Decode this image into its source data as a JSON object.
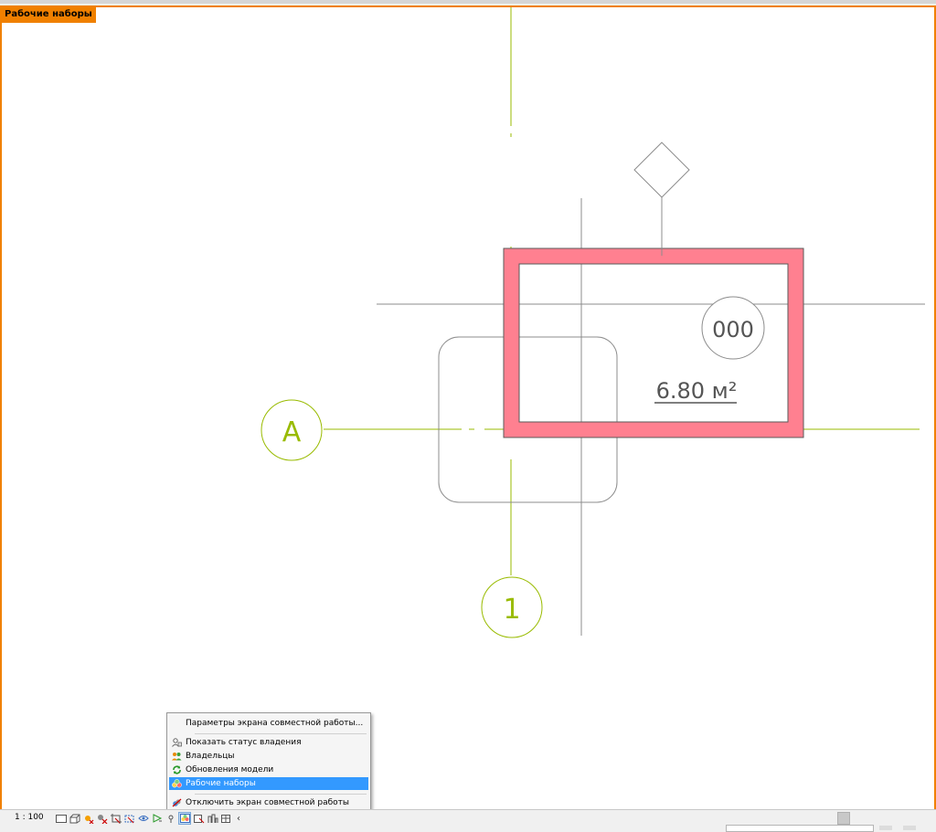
{
  "viewport": {
    "mode_label": "Рабочие наборы",
    "border_color": "#f08000"
  },
  "drawing": {
    "room_number": "000",
    "room_area": "6.80 м²",
    "grid_row_label": "A",
    "grid_column_label": "1",
    "room_highlight_color": "#ff8090",
    "grid_color": "#99bb00"
  },
  "statusbar": {
    "scale": "1 : 100",
    "icons": [
      "detail-level-icon",
      "visual-style-icon",
      "sun-path-icon",
      "shadows-icon",
      "crop-view-icon",
      "show-crop-icon",
      "temporary-hide-icon",
      "reveal-hidden-icon",
      "analytical-icon",
      "worksharing-display-icon",
      "highlight-displacement-icon",
      "reveal-constraints-icon",
      "design-options-icon"
    ],
    "expand_arrow": "‹"
  },
  "context_menu": {
    "items": [
      {
        "label": "Параметры экрана совместной работы...",
        "icon": ""
      },
      {
        "label": "Показать статус владения",
        "icon": "ownership-status-icon"
      },
      {
        "label": "Владельцы",
        "icon": "owners-icon"
      },
      {
        "label": "Обновления модели",
        "icon": "model-updates-icon"
      },
      {
        "label": "Рабочие наборы",
        "icon": "worksets-icon",
        "selected": true
      },
      {
        "label": "Отключить экран совместной работы",
        "icon": "disable-display-icon"
      }
    ]
  }
}
